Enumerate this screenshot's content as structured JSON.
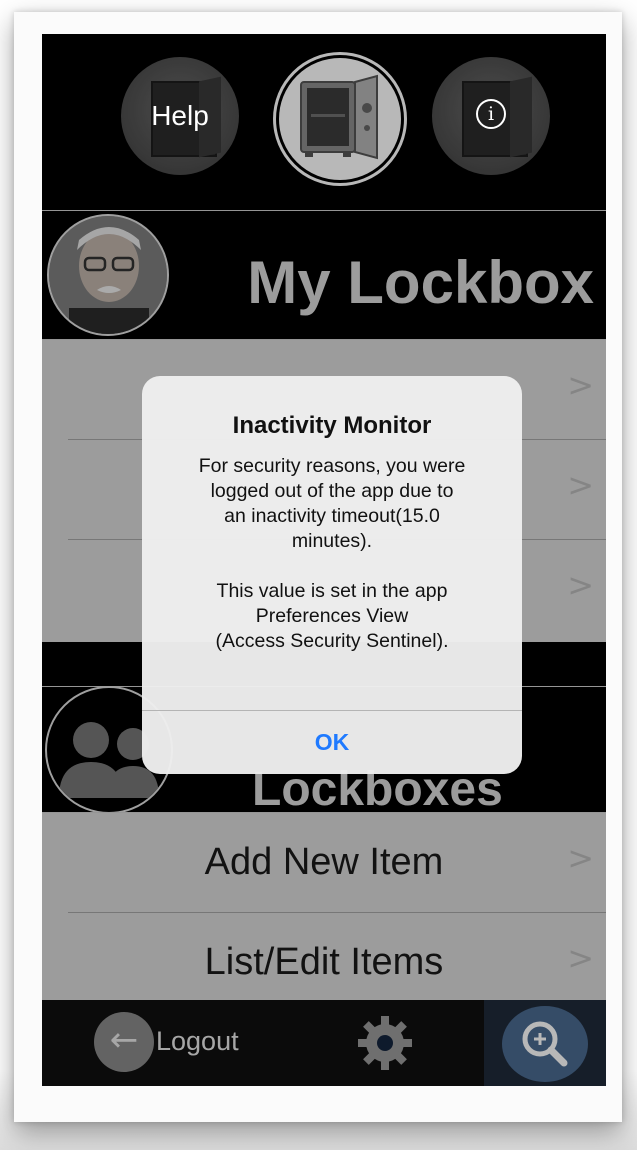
{
  "toolbar": {
    "help_label": "Help",
    "info_icon": "info-icon",
    "home_icon": "open-safe-icon"
  },
  "profile": {
    "title": "My Lockbox",
    "avatar": "user-photo"
  },
  "my_menu": {
    "rows": [
      {
        "label": ""
      },
      {
        "label": ""
      },
      {
        "label": ""
      }
    ],
    "chevron": ">"
  },
  "shared": {
    "title": "Lockboxes",
    "avatar": "group-icon"
  },
  "shared_menu": {
    "rows": [
      {
        "label": "Add New Item"
      },
      {
        "label": "List/Edit Items"
      }
    ]
  },
  "bottombar": {
    "logout_label": "Logout",
    "logout_icon": "back-arrow-icon",
    "settings_icon": "gear-icon",
    "search_icon": "zoom-in-icon"
  },
  "alert": {
    "title": "Inactivity Monitor",
    "message": "For security reasons, you were\nlogged out of the app due to\nan inactivity timeout(15.0\nminutes).\n\nThis value is set in the app\nPreferences View\n(Access Security Sentinel).",
    "ok_label": "OK"
  },
  "colors": {
    "accent": "#1f7aff",
    "menu_bg": "#d9d9d9",
    "header_bg": "#000000",
    "title_text": "#d9d9d9"
  }
}
